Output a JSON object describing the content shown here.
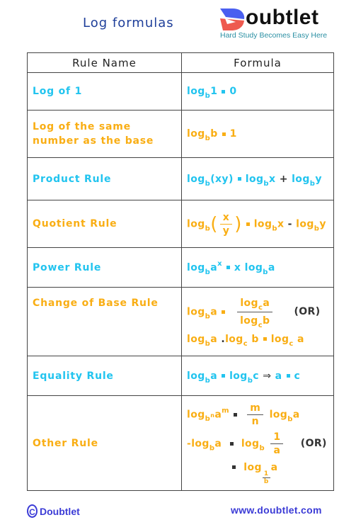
{
  "header": {
    "title": "Log formulas",
    "logo": {
      "name_rest": "oubtlet",
      "tagline": "Hard Study Becomes Easy Here"
    }
  },
  "table": {
    "columns": [
      "Rule Name",
      "Formula"
    ],
    "rows": [
      {
        "name": "Log of 1",
        "color": "blue"
      },
      {
        "name": "Log of the same number as the base",
        "color": "orange"
      },
      {
        "name": "Product Rule",
        "color": "blue"
      },
      {
        "name": "Quotient Rule",
        "color": "orange"
      },
      {
        "name": "Power Rule",
        "color": "blue"
      },
      {
        "name": "Change of Base Rule",
        "color": "orange"
      },
      {
        "name": "Equality Rule",
        "color": "blue"
      },
      {
        "name": "Other Rule",
        "color": "orange"
      }
    ],
    "formulas": {
      "log": "log",
      "b": "b",
      "c": "c",
      "a": "a",
      "x": "x",
      "y": "y",
      "m": "m",
      "n": "n",
      "one": "1",
      "zero": "0",
      "xy": "(xy)",
      "plus": "+",
      "minus": "-",
      "neg_log": "-log",
      "implies": "⇒",
      "dot": ".",
      "or": "(OR)"
    }
  },
  "colors": {
    "blue": "#22c4ef",
    "orange": "#f9ae14",
    "title": "#1f3f9a",
    "footer": "#3b3bd6"
  },
  "footer": {
    "copyright_symbol": "C",
    "brand": "Doubtlet",
    "url": "www.doubtlet.com"
  }
}
